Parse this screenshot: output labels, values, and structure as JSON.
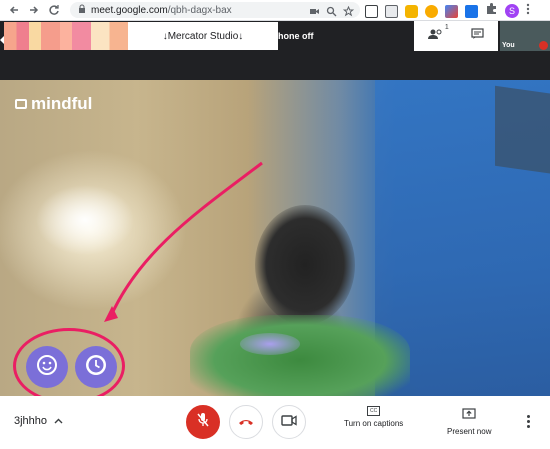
{
  "browser": {
    "url_domain": "meet.google.com",
    "url_path": "/qbh-dagx-bax",
    "profile_initial": "S"
  },
  "banner": {
    "studio_text": "↓Mercator Studio↓",
    "partial_text": "hone off"
  },
  "self_tile": {
    "label": "You"
  },
  "top_panel": {
    "participants_count": "1"
  },
  "video": {
    "watermark_text": "mindful",
    "watermark_faint": ""
  },
  "bottom_bar": {
    "meeting_code": "3jhhho",
    "captions_label": "Turn on captions",
    "present_label": "Present now",
    "cc_glyph": "CC"
  },
  "colors": {
    "accent_pink": "#ea1e63",
    "fab_purple": "#7b6fd8",
    "mic_red": "#d93025"
  }
}
